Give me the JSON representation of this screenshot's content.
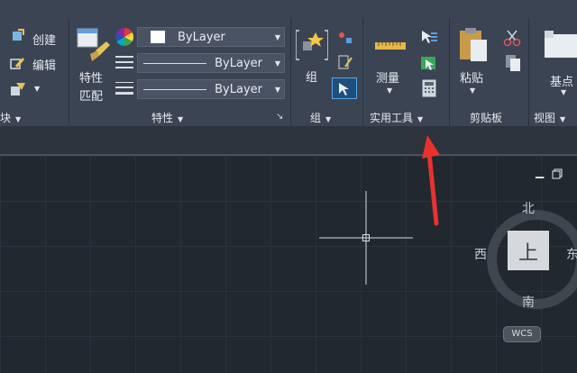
{
  "colors": {
    "ribbon_bg": "#3b4453",
    "canvas_bg": "#212830",
    "accent_arrow": "#e8322d"
  },
  "block_panel": {
    "create": "创建",
    "edit": "编辑",
    "label": "块"
  },
  "properties_panel": {
    "match": [
      "特性",
      "匹配"
    ],
    "color_value": "ByLayer",
    "linetype_value": "ByLayer",
    "lineweight_value": "ByLayer",
    "label": "特性"
  },
  "group_panel": {
    "group": "组",
    "label": "组"
  },
  "utilities_panel": {
    "measure": "测量",
    "label": "实用工具"
  },
  "clipboard_panel": {
    "paste": "粘贴",
    "label": "剪贴板"
  },
  "view_panel": {
    "base": "基点",
    "label": "视图"
  },
  "viewcube": {
    "north": "北",
    "south": "南",
    "west": "西",
    "east": "东",
    "face": "上",
    "wcs": "WCS"
  },
  "annotation": {
    "icon": "red-arrow-pointer"
  }
}
